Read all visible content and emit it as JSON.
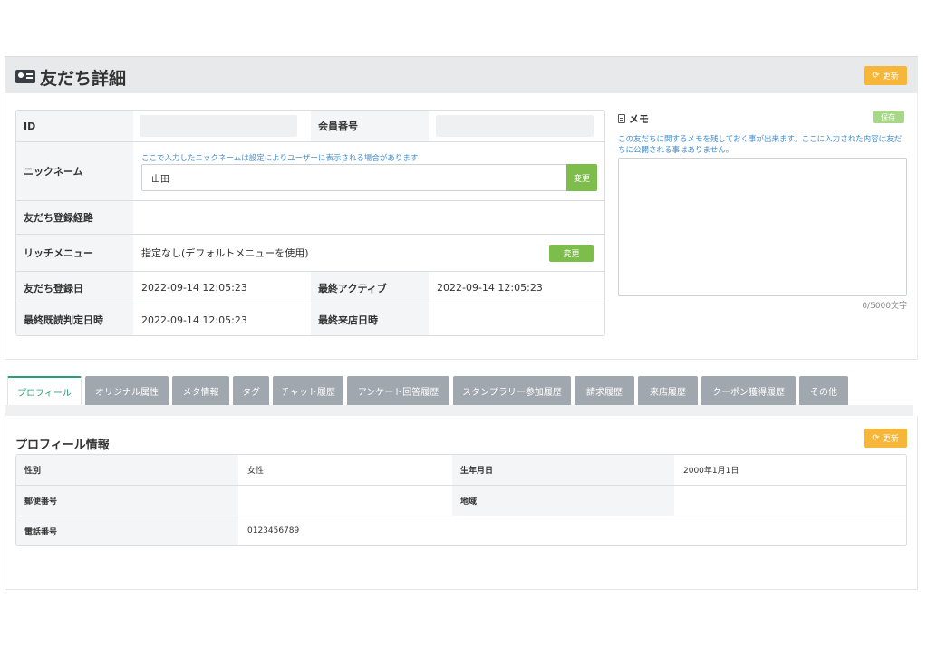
{
  "header": {
    "icon": "id-card-icon",
    "title": "友だち詳細",
    "refresh_label": "更新"
  },
  "info": {
    "id_label": "ID",
    "id_value": "",
    "member_no_label": "会員番号",
    "member_no_value": "",
    "nickname_label": "ニックネーム",
    "nickname_help": "ここで入力したニックネームは設定によりユーザーに表示される場合があります",
    "nickname_value": "山田",
    "nickname_change": "変更",
    "route_label": "友だち登録経路",
    "route_value": "",
    "rich_menu_label": "リッチメニュー",
    "rich_menu_value": "指定なし(デフォルトメニューを使用)",
    "rich_menu_change": "変更",
    "registered_label": "友だち登録日",
    "registered_value": "2022-09-14 12:05:23",
    "last_active_label": "最終アクティブ",
    "last_active_value": "2022-09-14 12:05:23",
    "last_read_label": "最終既読判定日時",
    "last_read_value": "2022-09-14 12:05:23",
    "last_visit_label": "最終来店日時",
    "last_visit_value": ""
  },
  "memo": {
    "title": "メモ",
    "save_label": "保存",
    "help": "この友だちに関するメモを残しておく事が出来ます。ここに入力された内容は友だちに公開される事はありません。",
    "value": "",
    "count": "0/5000文字"
  },
  "tabs": [
    {
      "label": "プロフィール",
      "active": true
    },
    {
      "label": "オリジナル属性"
    },
    {
      "label": "メタ情報"
    },
    {
      "label": "タグ"
    },
    {
      "label": "チャット履歴"
    },
    {
      "label": "アンケート回答履歴"
    },
    {
      "label": "スタンプラリー参加履歴"
    },
    {
      "label": "請求履歴"
    },
    {
      "label": "来店履歴"
    },
    {
      "label": "クーポン獲得履歴"
    },
    {
      "label": "その他"
    }
  ],
  "profile": {
    "title": "プロフィール情報",
    "refresh_label": "更新",
    "gender_label": "性別",
    "gender_value": "女性",
    "birthday_label": "生年月日",
    "birthday_value": "2000年1月1日",
    "postal_label": "郵便番号",
    "postal_value": "",
    "region_label": "地域",
    "region_value": "",
    "phone_label": "電話番号",
    "phone_value": "0123456789"
  },
  "colors": {
    "accent_orange": "#f5b63a",
    "accent_green": "#7cbd4c",
    "link_blue": "#3e8bd0",
    "tab_grey": "#a1a7ae",
    "tab_active": "#2f9c7b"
  }
}
